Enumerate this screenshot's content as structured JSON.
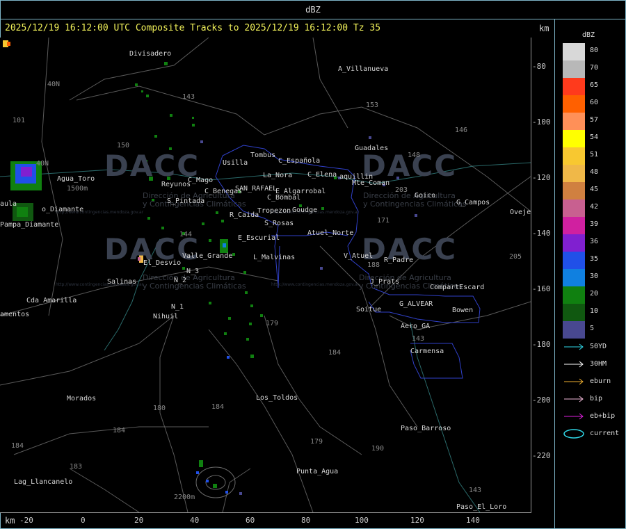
{
  "titlebar": {
    "label": "dBZ"
  },
  "header": {
    "text": "2025/12/19 16:12:00 UTC Composite Tracks to 2025/12/19 16:12:00 Tz 35",
    "km_label": "km"
  },
  "axes": {
    "x_label": "km",
    "x_ticks": [
      "-20",
      "0",
      "20",
      "40",
      "60",
      "80",
      "100",
      "120",
      "140"
    ],
    "y_ticks": [
      "-80",
      "-100",
      "-120",
      "-140",
      "-160",
      "-180",
      "-200",
      "-220"
    ]
  },
  "legend": {
    "title": "dBZ",
    "scale": [
      {
        "label": "80",
        "color": "#d8d8d8"
      },
      {
        "label": "70",
        "color": "#b8b8b8"
      },
      {
        "label": "65",
        "color": "#ff3a1c"
      },
      {
        "label": "60",
        "color": "#ff6000"
      },
      {
        "label": "57",
        "color": "#ff9058"
      },
      {
        "label": "54",
        "color": "#ffff00"
      },
      {
        "label": "51",
        "color": "#f8c830"
      },
      {
        "label": "48",
        "color": "#f0b848"
      },
      {
        "label": "45",
        "color": "#d08040"
      },
      {
        "label": "42",
        "color": "#c86090"
      },
      {
        "label": "39",
        "color": "#d020a0"
      },
      {
        "label": "36",
        "color": "#8020d0"
      },
      {
        "label": "35",
        "color": "#2050e8"
      },
      {
        "label": "30",
        "color": "#1080e0"
      },
      {
        "label": "20",
        "color": "#108010"
      },
      {
        "label": "10",
        "color": "#105810"
      },
      {
        "label": "5",
        "color": "#484890"
      }
    ],
    "tracks": [
      {
        "label": "50YD",
        "color": "#30d8e8"
      },
      {
        "label": "30HM",
        "color": "#ffffff"
      },
      {
        "label": "eburn",
        "color": "#f0b030"
      },
      {
        "label": "bip",
        "color": "#f0b8d8"
      },
      {
        "label": "eb+bip",
        "color": "#e020e0"
      },
      {
        "label": "current",
        "color": "#30d8e8"
      }
    ]
  },
  "watermark": {
    "brand": "DACC",
    "line1": "Dirección de Agricultura",
    "line2": "y Contingencias Climáticas",
    "url": "http://www.contingencias.mendoza.gov.ar"
  },
  "towns": {
    "divisadero": "Divisadero",
    "a_villanueva": "A_Villanueva",
    "guadales": "Guadales",
    "tombus": "Tombus",
    "usilla": "Usilla",
    "c_espanola": "C_Española",
    "la_nora": "La_Nora",
    "c_elena": "C_Elena",
    "aquillin": "aquillin",
    "mte_coman": "Mte_Coman",
    "goico": "Goico",
    "g_campos": "G_Campos",
    "ovejeria": "Ovejer",
    "agua_toro": "Agua_Toro",
    "reyunos": "Reyunos",
    "cmago": "C_Mago",
    "c_benegas": "C_Benegas",
    "san_rafael": "SAN_RAFAEL",
    "e_algarrobal": "E_Algarrobal",
    "c_bombal": "C_Bombal",
    "s_pintada": "S_Pintada",
    "tropezon": "Tropezon",
    "goudge": "Goudge",
    "r_caida": "R_Caida",
    "s_rosas": "S_Rosas",
    "atuel_norte": "Atuel_Norte",
    "e_escurial": "E_Escurial",
    "pampa_diamante": "Pampa_Diamante",
    "po_diamante": "o_Diamante",
    "laura": "aula",
    "valle_grande": "Valle_Grande",
    "l_malvinas": "L_Malvinas",
    "v_atuel": "V_Atuel",
    "r_padre": "R_Padre",
    "el_desvio": "El_Desvio",
    "salinas": "Salinas",
    "j_prats": "J_Prats",
    "compart_escard": "CompartEscard",
    "n_2": "N_2",
    "n_3": "N_3",
    "cda_amarilla": "Cda_Amarilla",
    "n_1": "N_1",
    "nihuil": "Nihuil",
    "soitue": "Soitue",
    "g_alvear": "G_ALVEAR",
    "bowen": "Bowen",
    "aeropuerto": "Aero_GA",
    "carmensa": "Carmensa",
    "lamentos": "amentos",
    "morados": "Morados",
    "los_toldos": "Los_Toldos",
    "paso_barroso": "Paso_Barroso",
    "punta_agua": "Punta_Agua",
    "lag_llancanelo": "Lag_Llancanelo",
    "paso_el_loro": "Paso_El_Loro"
  },
  "roads": {
    "r143a": "143",
    "r153": "153",
    "r146": "146",
    "r40n": "40N",
    "r101": "101",
    "r150": "150",
    "r148": "148",
    "r203": "203",
    "r40n2": "40N",
    "r171": "171",
    "r144": "144",
    "r188": "188",
    "r205": "205",
    "r179": "179",
    "r184": "184",
    "r143b": "143",
    "r180": "180",
    "r184b": "184",
    "r184c": "184",
    "r179b": "179",
    "r190": "190",
    "r183": "183",
    "r143c": "143",
    "r184d": "184",
    "elev1500": "1500m",
    "elev2200": "2200m"
  }
}
